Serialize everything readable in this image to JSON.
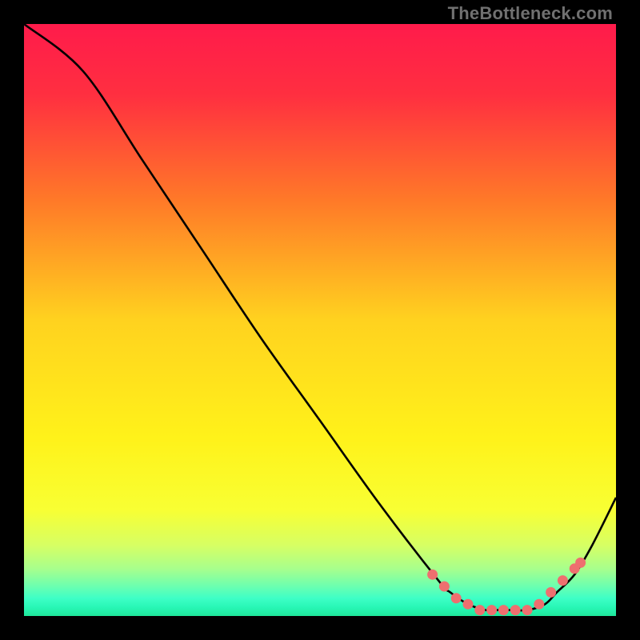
{
  "watermark": "TheBottleneck.com",
  "chart_data": {
    "type": "line",
    "title": "",
    "xlabel": "",
    "ylabel": "",
    "xlim": [
      0,
      100
    ],
    "ylim": [
      0,
      100
    ],
    "x": [
      0,
      10,
      20,
      30,
      40,
      50,
      60,
      70,
      72,
      75,
      78,
      80,
      82,
      85,
      88,
      90,
      93,
      96,
      100
    ],
    "values": [
      100,
      92,
      77,
      62,
      47,
      33,
      19,
      6,
      4,
      2,
      1,
      1,
      1,
      1,
      2,
      4,
      7,
      12,
      20
    ],
    "markers": {
      "x": [
        69,
        71,
        73,
        75,
        77,
        79,
        81,
        83,
        85,
        87,
        89,
        91,
        93,
        94
      ],
      "values": [
        7,
        5,
        3,
        2,
        1,
        1,
        1,
        1,
        1,
        2,
        4,
        6,
        8,
        9
      ]
    },
    "gradient_stops": [
      {
        "offset": 0.0,
        "color": "#ff1b4b"
      },
      {
        "offset": 0.12,
        "color": "#ff2f40"
      },
      {
        "offset": 0.3,
        "color": "#ff7a28"
      },
      {
        "offset": 0.5,
        "color": "#ffd21f"
      },
      {
        "offset": 0.7,
        "color": "#fff21a"
      },
      {
        "offset": 0.82,
        "color": "#f8ff33"
      },
      {
        "offset": 0.88,
        "color": "#d7ff63"
      },
      {
        "offset": 0.92,
        "color": "#a8ff8c"
      },
      {
        "offset": 0.95,
        "color": "#6bffb0"
      },
      {
        "offset": 0.97,
        "color": "#3effc6"
      },
      {
        "offset": 0.985,
        "color": "#28f7b6"
      },
      {
        "offset": 1.0,
        "color": "#1fe79a"
      }
    ],
    "marker_color": "#ee6f6f",
    "line_color": "#000000"
  }
}
